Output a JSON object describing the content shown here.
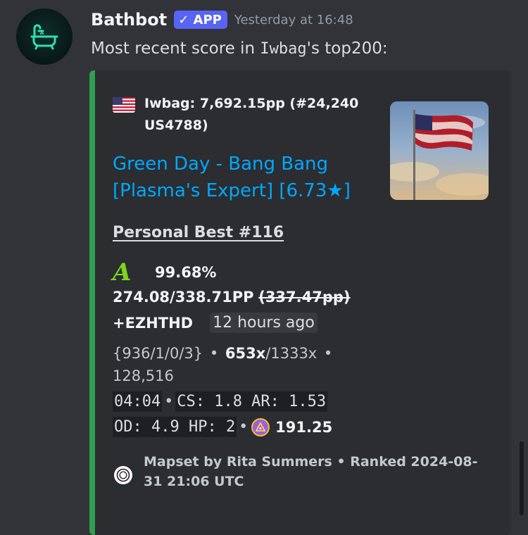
{
  "message": {
    "username": "Bathbot",
    "badge": "✓ APP",
    "timestamp": "Yesterday at 16:48",
    "text_before": "Most recent score in ",
    "text_user": "Iwbag",
    "text_after": "'s top200:"
  },
  "embed": {
    "accent_color": "#2f9e4f",
    "author": "Iwbag: 7,692.15pp (#24,240 US4788)",
    "author_icon": "us-flag-icon",
    "title": "Green Day - Bang Bang [Plasma's Expert] [6.73★]",
    "personal_best": "Personal Best #116",
    "grade": "A",
    "accuracy": "99.68%",
    "pp_value": "274.08/338.71PP",
    "pp_fc": "(337.47pp)",
    "mods": "+EZHTHD",
    "relative_time": "12 hours ago",
    "hits": "{936/1/0/3}",
    "dot": "•",
    "combo": "653x",
    "max_combo": "/1333x",
    "score": "128,516",
    "length": "04:04",
    "cs_ar": "CS: 1.8 AR: 1.53",
    "od_hp": "OD: 4.9 HP: 2",
    "star_rating_value": "191.25",
    "footer": "Mapset by Rita Summers • Ranked 2024-08-31 21:06 UTC",
    "footer_icon": "osu-icon"
  }
}
